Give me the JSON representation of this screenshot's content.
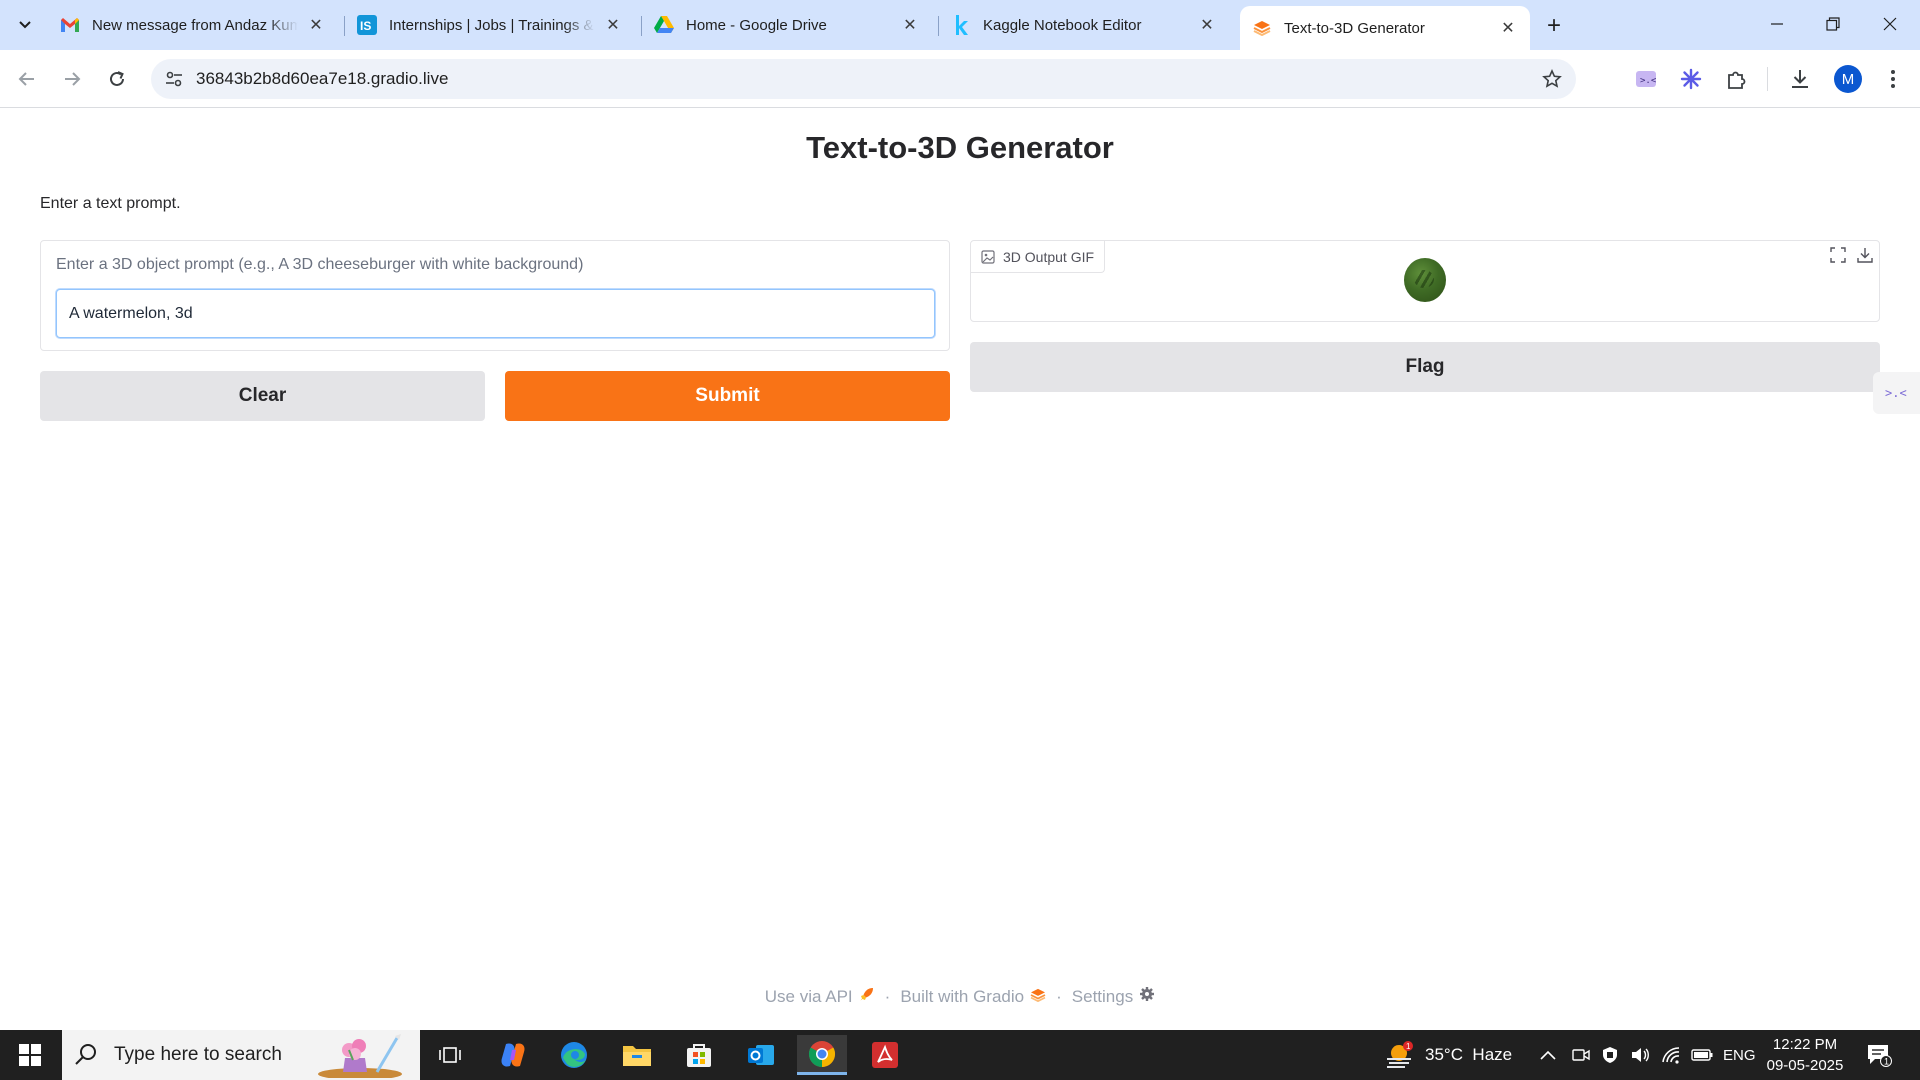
{
  "browser": {
    "tabs": [
      {
        "title": "New message from Andaz Kumar",
        "favicon": "gmail-icon",
        "active": false
      },
      {
        "title": "Internships | Jobs | Trainings & Online Courses",
        "favicon": "internshala-icon",
        "active": false
      },
      {
        "title": "Home - Google Drive",
        "favicon": "google-drive-icon",
        "active": false
      },
      {
        "title": "Kaggle Notebook Editor",
        "favicon": "kaggle-icon",
        "active": false
      },
      {
        "title": "Text-to-3D Generator",
        "favicon": "gradio-icon",
        "active": true
      }
    ],
    "url": "36843b2b8d60ea7e18.gradio.live",
    "profile_initial": "M"
  },
  "app": {
    "title": "Text-to-3D Generator",
    "description": "Enter a text prompt.",
    "input_label": "Enter a 3D object prompt (e.g., A 3D cheeseburger with white background)",
    "input_value": "A watermelon, 3d",
    "clear_label": "Clear",
    "submit_label": "Submit",
    "output_label": "3D Output GIF",
    "flag_label": "Flag",
    "submit_color": "#f97316"
  },
  "footer": {
    "api": "Use via API",
    "built": "Built with Gradio",
    "settings": "Settings"
  },
  "taskbar": {
    "search_placeholder": "Type here to search",
    "weather": "35°C  Haze",
    "weather_badge": "1",
    "language": "ENG",
    "time": "12:22 PM",
    "date": "09-05-2025",
    "notification_count": "1"
  }
}
